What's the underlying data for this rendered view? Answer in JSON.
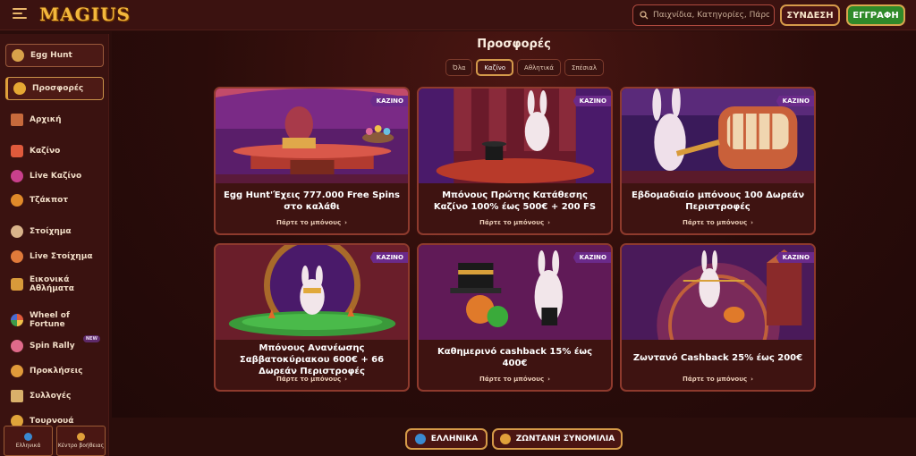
{
  "header": {
    "logo": "MAGIUS",
    "search_placeholder": "Παιχνίδια, Κατηγορίες, Πάροχοι",
    "login_label": "ΣΥΝΔΕΣΗ",
    "register_label": "ΕΓΓΡΑΦΗ"
  },
  "sidebar": {
    "items": [
      {
        "label": "Egg Hunt"
      },
      {
        "label": "Προσφορές"
      },
      {
        "label": "Αρχική"
      },
      {
        "label": "Καζίνο"
      },
      {
        "label": "Live Καζίνο"
      },
      {
        "label": "Τζάκποτ"
      },
      {
        "label": "Στοίχημα"
      },
      {
        "label": "Live Στοίχημα"
      },
      {
        "label": "Εικονικά Αθλήματα"
      },
      {
        "label": "Wheel of Fortune"
      },
      {
        "label": "Spin Rally",
        "badge": "NEW"
      },
      {
        "label": "Προκλήσεις"
      },
      {
        "label": "Συλλογές"
      },
      {
        "label": "Τουρνουά"
      }
    ],
    "bottom": {
      "language": "Ελληνικά",
      "help": "Κέντρο βοήθειας"
    }
  },
  "main": {
    "title": "Προσφορές",
    "tabs": [
      "Όλα",
      "Καζίνο",
      "Αθλητικά",
      "Σπέσιαλ"
    ],
    "selected_tab": "Καζίνο",
    "cards": [
      {
        "tag": "ΚΑΖΙΝΟ",
        "title": "Egg Hunt'Έχεις 777.000 Free Spins στο καλάθι",
        "cta": "Πάρτε το μπόνους"
      },
      {
        "tag": "ΚΑΖΙΝΟ",
        "title": "Μπόνους Πρώτης Κατάθεσης Καζίνο 100% έως 500€ + 200 FS",
        "cta": "Πάρτε το μπόνους"
      },
      {
        "tag": "ΚΑΖΙΝΟ",
        "title": "Εβδομαδιαίο μπόνους 100 Δωρεάν Περιστροφές",
        "cta": "Πάρτε το μπόνους"
      },
      {
        "tag": "ΚΑΖΙΝΟ",
        "title": "Μπόνους Ανανέωσης Σαββατοκύριακου 600€ + 66 Δωρεάν Περιστροφές",
        "cta": "Πάρτε το μπόνους"
      },
      {
        "tag": "ΚΑΖΙΝΟ",
        "title": "Καθημερινό cashback 15% έως 400€",
        "cta": "Πάρτε το μπόνους"
      },
      {
        "tag": "ΚΑΖΙΝΟ",
        "title": "Ζωντανό Cashback 25% έως 200€",
        "cta": "Πάρτε το μπόνους"
      }
    ]
  },
  "footer_buttons": {
    "language": "ΕΛΛΗΝΙΚΑ",
    "chat": "ΖΩΝΤΑΝΗ ΣΥΝΟΜΙΛΙΑ"
  }
}
